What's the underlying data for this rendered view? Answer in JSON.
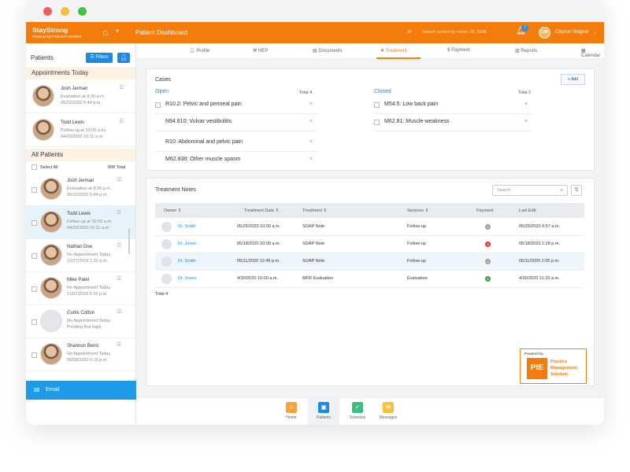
{
  "app": {
    "brand": "StayStrong",
    "brand_sub": "Powered by PTEVERYWHERE",
    "page_title": "Patient Dashboard",
    "search_placeholder": "Search patient by name, ID, DOB",
    "notif_count": "7",
    "user_initials": "CW",
    "user_name": "Clayton Wagner"
  },
  "sidebar": {
    "title": "Patients",
    "filters_label": "Filters",
    "appointments_title": "Appointments Today",
    "appointments": [
      {
        "name": "Josh Jerman",
        "line1": "Evaluation at 8:30 a.m.",
        "line2": "05/22/2020 5:44 p.m."
      },
      {
        "name": "Todd Lewis",
        "line1": "Follow-up at 10:00 a.m.",
        "line2": "04/29/2020 10:11 a.m."
      }
    ],
    "all_title": "All Patients",
    "select_all": "Select All",
    "total": "898 Total",
    "patients": [
      {
        "name": "Josh Jerman",
        "line1": "Evaluation at 8:30 a.m.",
        "line2": "05/22/2020 5:44 p.m."
      },
      {
        "name": "Todd Lewis",
        "line1": "Follow-up at 10:00 a.m.",
        "line2": "04/29/2020 10:11 a.m."
      },
      {
        "name": "Nathan Doe",
        "line1": "No Appointment Today",
        "line2": "12/27/2019 1:32 p.m."
      },
      {
        "name": "Mike Patel",
        "line1": "No Appointment Today",
        "line2": "11/07/2019 5:16 p.m."
      },
      {
        "name": "Curtis Cotton",
        "line1": "No Appointment Today",
        "line2": "Pending first login"
      },
      {
        "name": "Shannon Benic",
        "line1": "No Appointment Today",
        "line2": "05/08/2020 5:16 p.m."
      }
    ],
    "email_label": "Email"
  },
  "tabs": [
    "Profile",
    "HEP",
    "Documents",
    "Treatment",
    "Payment",
    "Reports",
    "Calendar"
  ],
  "cases": {
    "title": "Cases",
    "add_label": "+ Add",
    "open_label": "Open",
    "open_total": "Total 4",
    "open_items": [
      "R10.2:  Pelvic and perineal pain",
      "N94.810:  Vulvar vestibulitis",
      "R10:  Abdominal and pelvic pain",
      "M62.838:  Other muscle spasm"
    ],
    "closed_label": "Closed",
    "closed_total": "Total 2",
    "closed_items": [
      "M54.5: Low back pain",
      "M62.81:  Muscle weakness"
    ]
  },
  "notes": {
    "title": "Treatment Notes",
    "search_placeholder": "Search...",
    "headers": [
      "Owner",
      "Treatment Date",
      "Treatment",
      "Services",
      "Payment",
      "Last Edit"
    ],
    "rows": [
      {
        "owner": "Dr. Smith",
        "date": "05/25/2020 10:00 a.m.",
        "treatment": "SOAP Note",
        "services": "Follow-up",
        "payment_status": "none",
        "last_edit": "05/25/2020 9:57 a.m."
      },
      {
        "owner": "Dr. Jones",
        "date": "05/18/2020 10:00 a.m.",
        "treatment": "SOAP Note",
        "services": "Follow-up",
        "payment_status": "unpaid",
        "last_edit": "05/18/2020 1:28 p.m."
      },
      {
        "owner": "Dr. Smith",
        "date": "05/11/2020 12:45 p.m.",
        "treatment": "SOAP Note",
        "services": "Follow-up",
        "payment_status": "none",
        "last_edit": "05/11/2020 2:05 p.m."
      },
      {
        "owner": "Dr. Jones",
        "date": "4/30/2020  10:00 a.m.",
        "treatment": "MFR Evaluation",
        "services": "Evaluation",
        "payment_status": "paid",
        "last_edit": "4/30/2020  11:33 a.m."
      }
    ],
    "total": "Total 4"
  },
  "pte": {
    "powered": "Powered by",
    "logo": "PtE",
    "line1": "Practice",
    "line2": "Management",
    "line3": "Solution"
  },
  "bottom_nav": [
    "Home",
    "Patients",
    "Schedule",
    "Messages"
  ],
  "colors": {
    "brand": "#f47c0c",
    "accent": "#1e88e5",
    "unpaid": "#e53935",
    "paid": "#43a047",
    "neutral": "#9e9e9e"
  }
}
